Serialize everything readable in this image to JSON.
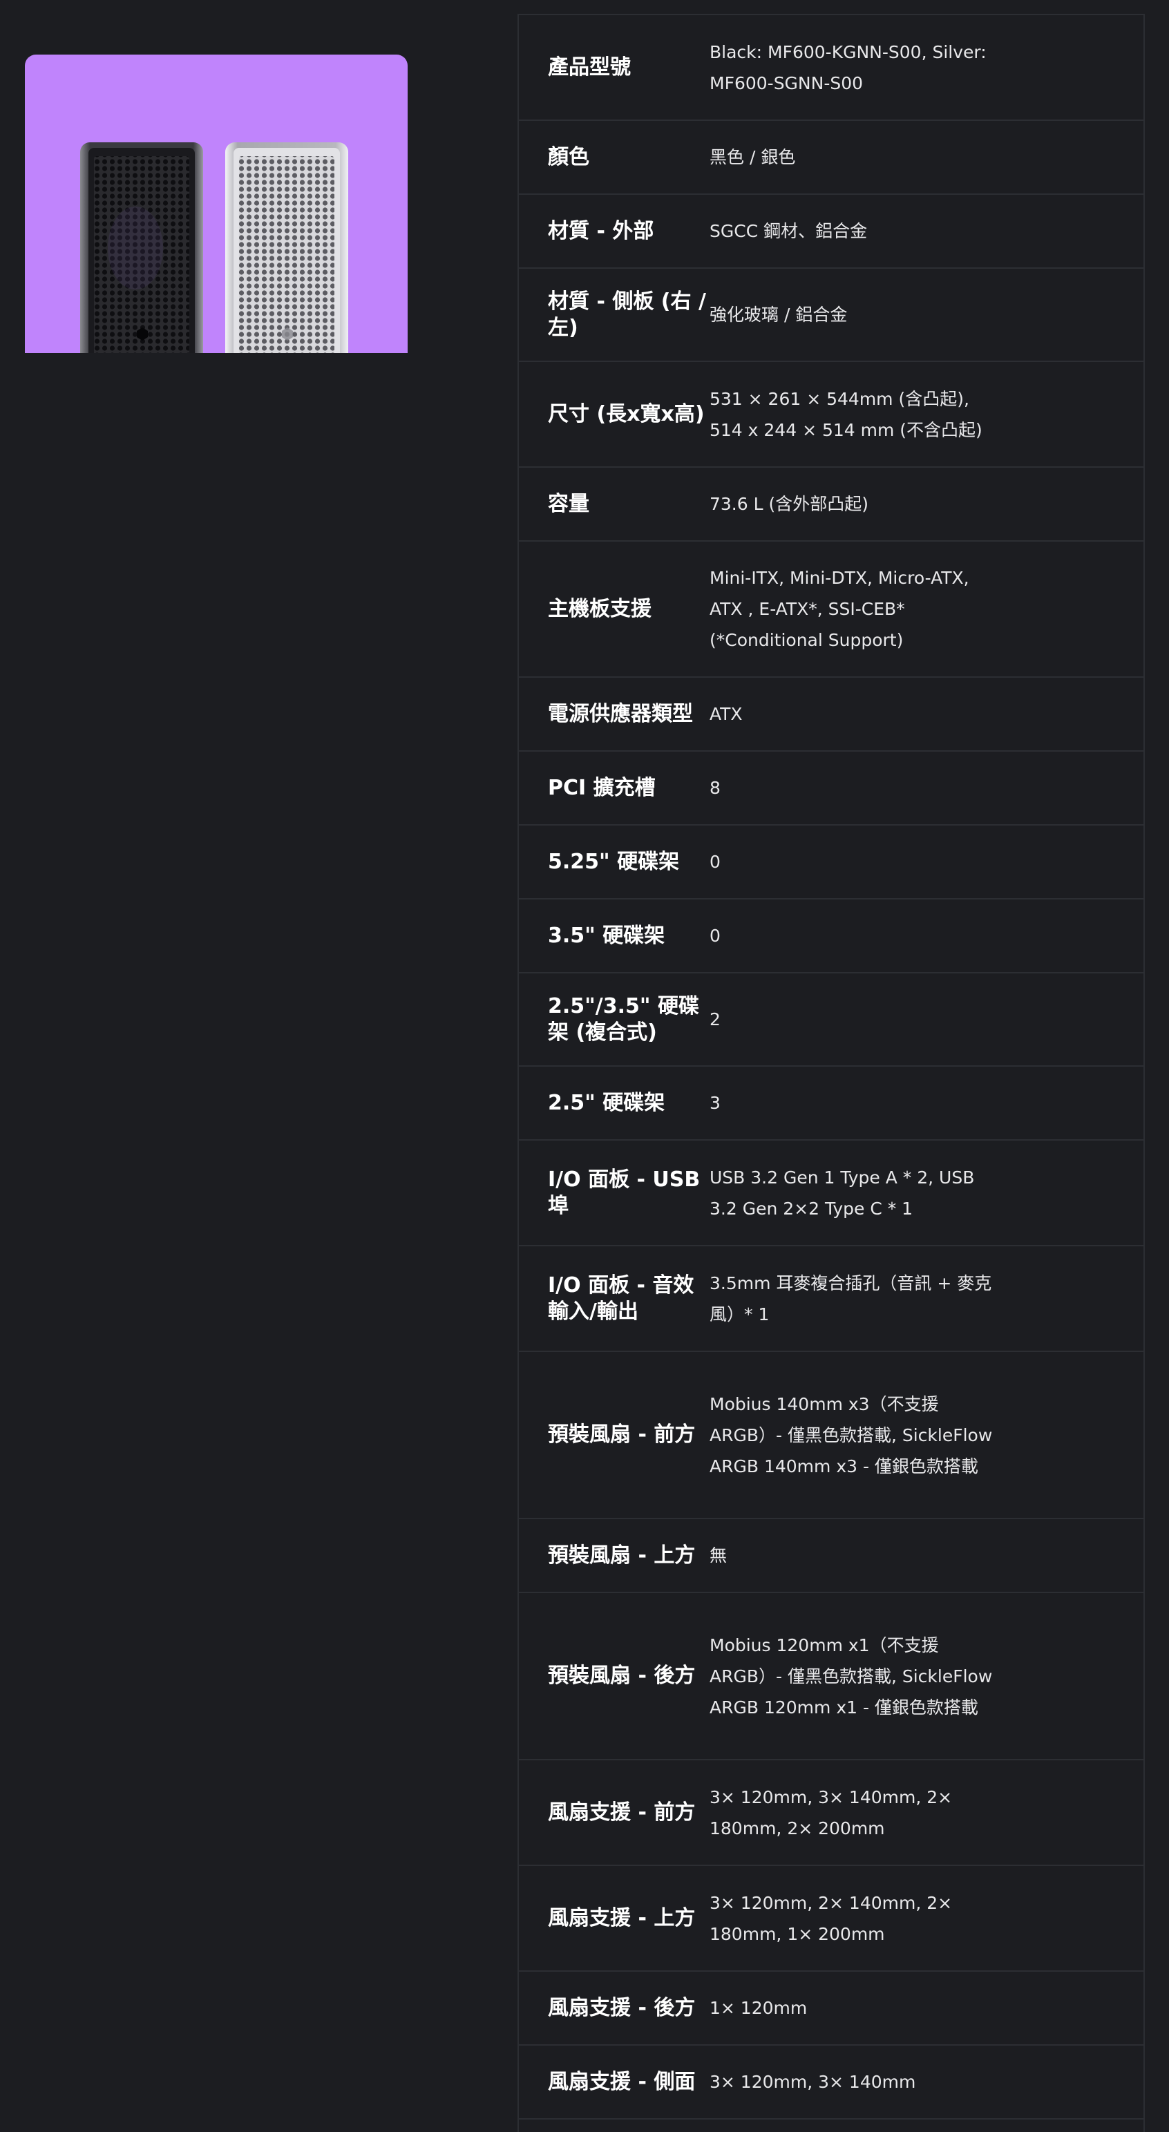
{
  "product_image": {
    "alt": "",
    "background_color": "#c084fc",
    "variants": [
      "black-case",
      "silver-case"
    ]
  },
  "specs": [
    {
      "label": "產品型號",
      "value": "Black: MF600-KGNN-S00, Silver: MF600-SGNN-S00"
    },
    {
      "label": "顏色",
      "value": "黑色 / 銀色"
    },
    {
      "label": "材質 - 外部",
      "value": "SGCC 鋼材、鋁合金"
    },
    {
      "label": "材質 - 側板 (右 / 左)",
      "value": "強化玻璃 / 鋁合金"
    },
    {
      "label": "尺寸 (長x寬x高)",
      "value": "531 × 261 × 544mm (含凸起), 514 x 244 × 514 mm (不含凸起)"
    },
    {
      "label": "容量",
      "value": "73.6 L (含外部凸起)"
    },
    {
      "label": "主機板支援",
      "value": "Mini-ITX, Mini-DTX, Micro-ATX, ATX , E-ATX*, SSI-CEB* (*Conditional Support)"
    },
    {
      "label": "電源供應器類型",
      "value": "ATX"
    },
    {
      "label": "PCI 擴充槽",
      "value": "8"
    },
    {
      "label": "5.25\" 硬碟架",
      "value": "0"
    },
    {
      "label": "3.5\" 硬碟架",
      "value": "0"
    },
    {
      "label": "2.5\"/3.5\" 硬碟架 (複合式)",
      "value": "2"
    },
    {
      "label": "2.5\" 硬碟架",
      "value": "3"
    },
    {
      "label": "I/O 面板 - USB 埠",
      "value": "USB 3.2 Gen 1 Type A * 2, USB 3.2 Gen 2×2 Type C * 1"
    },
    {
      "label": "I/O 面板 - 音效輸入/輸出",
      "value": "3.5mm 耳麥複合插孔（音訊 + 麥克風）* 1"
    },
    {
      "label": "預裝風扇 - 前方",
      "value": "Mobius 140mm x3（不支援 ARGB）- 僅黑色款搭載, SickleFlow ARGB 140mm x3 - 僅銀色款搭載"
    },
    {
      "label": "預裝風扇 - 上方",
      "value": "無"
    },
    {
      "label": "預裝風扇 - 後方",
      "value": "Mobius 120mm x1（不支援 ARGB）- 僅黑色款搭載, SickleFlow ARGB 120mm x1 - 僅銀色款搭載"
    },
    {
      "label": "風扇支援 - 前方",
      "value": "3× 120mm, 3× 140mm, 2× 180mm, 2× 200mm"
    },
    {
      "label": "風扇支援 - 上方",
      "value": "3× 120mm, 2× 140mm, 2× 180mm, 1× 200mm"
    },
    {
      "label": "風扇支援 - 後方",
      "value": "1× 120mm"
    },
    {
      "label": "風扇支援 - 側面",
      "value": "3× 120mm, 3× 140mm"
    }
  ]
}
